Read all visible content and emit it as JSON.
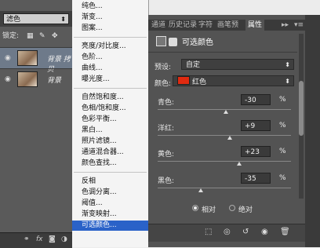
{
  "layers_panel": {
    "mode": "滤色",
    "lock_label": "锁定:",
    "layers": [
      {
        "name": "背景 拷贝"
      },
      {
        "name": "背景"
      }
    ]
  },
  "adjust_menu": {
    "items": [
      "纯色...",
      "渐变...",
      "图案...",
      "亮度/对比度...",
      "色阶...",
      "曲线...",
      "曝光度...",
      "自然饱和度...",
      "色相/饱和度...",
      "色彩平衡...",
      "黑白...",
      "照片滤镜...",
      "通道混合器...",
      "颜色查找...",
      "反相",
      "色调分离...",
      "阈值...",
      "渐变映射...",
      "可选颜色..."
    ],
    "highlighted": "可选颜色..."
  },
  "properties": {
    "tabs": [
      "通道",
      "历史记录",
      "字符",
      "画笔预",
      "属性"
    ],
    "active_tab": "属性",
    "title": "可选颜色",
    "preset_label": "预设:",
    "preset_value": "自定",
    "colors_label": "颜色:",
    "colors_value": "红色",
    "swatch_color": "#e02a10",
    "sliders": [
      {
        "label": "青色:",
        "value": "-30",
        "unit": "%",
        "level": -30
      },
      {
        "label": "洋红:",
        "value": "+9",
        "unit": "%",
        "level": 9
      },
      {
        "label": "黄色:",
        "value": "+23",
        "unit": "%",
        "level": 23
      },
      {
        "label": "黑色:",
        "value": "-35",
        "unit": "%",
        "level": -35
      }
    ],
    "method_relative": "相对",
    "method_absolute": "绝对"
  }
}
